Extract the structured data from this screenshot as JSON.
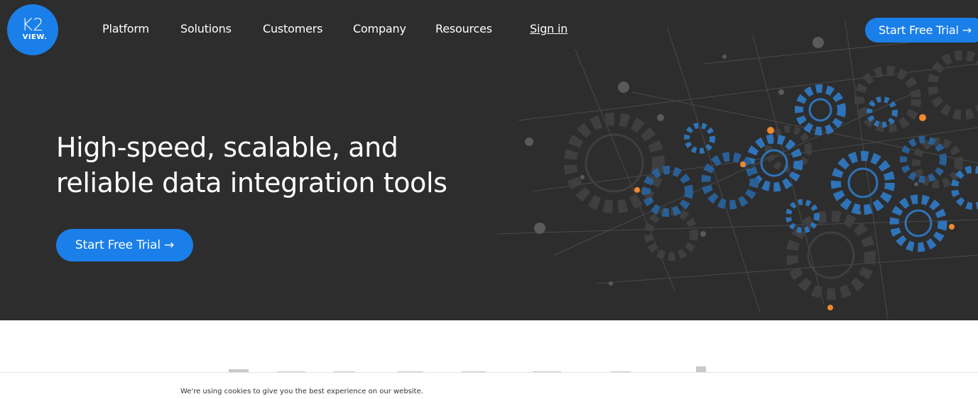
{
  "brand": {
    "logo_top": "K2",
    "logo_bottom": "VIEW.",
    "accent_color": "#1a7fe8",
    "hero_bg": "#2d2d2d",
    "highlight_color": "#f0882e"
  },
  "nav": {
    "items": [
      {
        "label": "Platform"
      },
      {
        "label": "Solutions"
      },
      {
        "label": "Customers"
      },
      {
        "label": "Company"
      },
      {
        "label": "Resources"
      }
    ],
    "signin_label": "Sign in",
    "cta_label": "Start Free Trial →"
  },
  "hero": {
    "headline_line1": "High-speed, scalable, and",
    "headline_line2": "reliable data integration tools",
    "cta_label": "Start Free Trial →",
    "illustration_icon": "gears-network-icon"
  },
  "cookie": {
    "text": "We're using cookies to give you the best experience on our website."
  }
}
